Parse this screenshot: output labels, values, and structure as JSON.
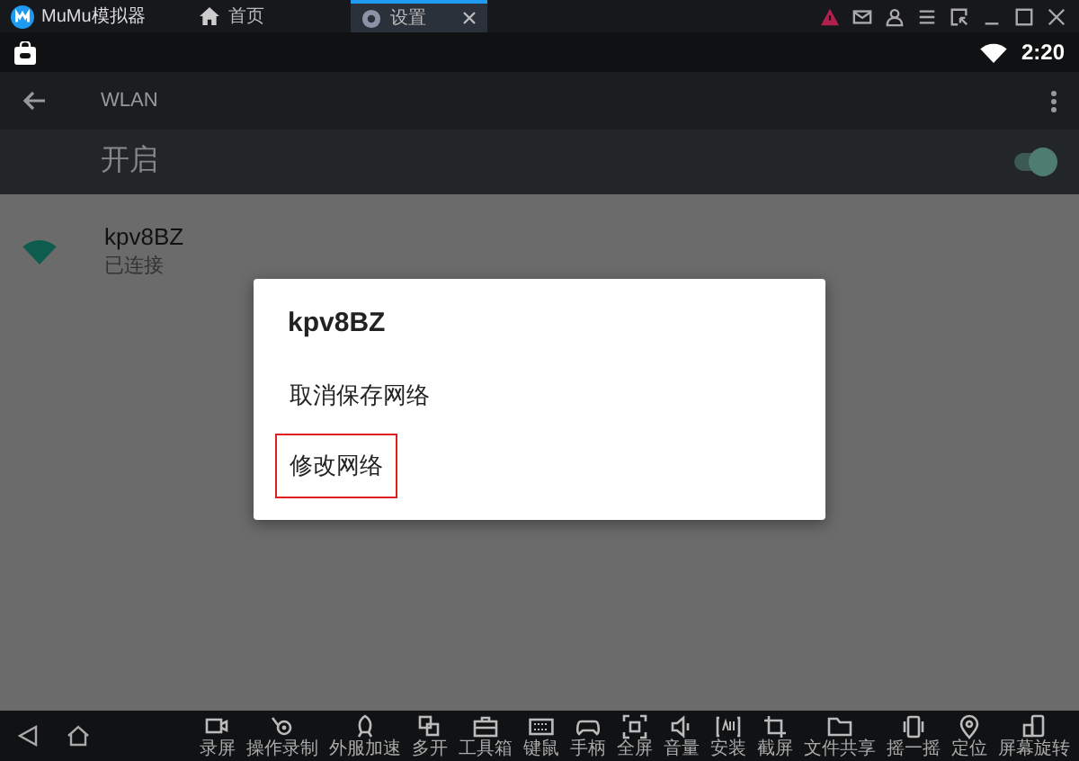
{
  "app": {
    "title": "MuMu模拟器"
  },
  "tabs": [
    {
      "label": "首页",
      "selected": false
    },
    {
      "label": "设置",
      "selected": true
    }
  ],
  "status_bar": {
    "time": "2:20"
  },
  "app_bar": {
    "title": "WLAN"
  },
  "wifi_switch": {
    "label": "开启",
    "on": true
  },
  "networks": [
    {
      "name": "kpv8BZ",
      "status": "已连接"
    }
  ],
  "dialog": {
    "title": "kpv8BZ",
    "options": [
      {
        "label": "取消保存网络",
        "highlighted": false
      },
      {
        "label": "修改网络",
        "highlighted": true
      }
    ]
  },
  "toolbar": [
    {
      "label": "录屏"
    },
    {
      "label": "操作录制"
    },
    {
      "label": "外服加速"
    },
    {
      "label": "多开"
    },
    {
      "label": "工具箱"
    },
    {
      "label": "键鼠"
    },
    {
      "label": "手柄"
    },
    {
      "label": "全屏"
    },
    {
      "label": "音量"
    },
    {
      "label": "安装"
    },
    {
      "label": "截屏"
    },
    {
      "label": "文件共享"
    },
    {
      "label": "摇一摇"
    },
    {
      "label": "定位"
    },
    {
      "label": "屏幕旋转"
    }
  ]
}
